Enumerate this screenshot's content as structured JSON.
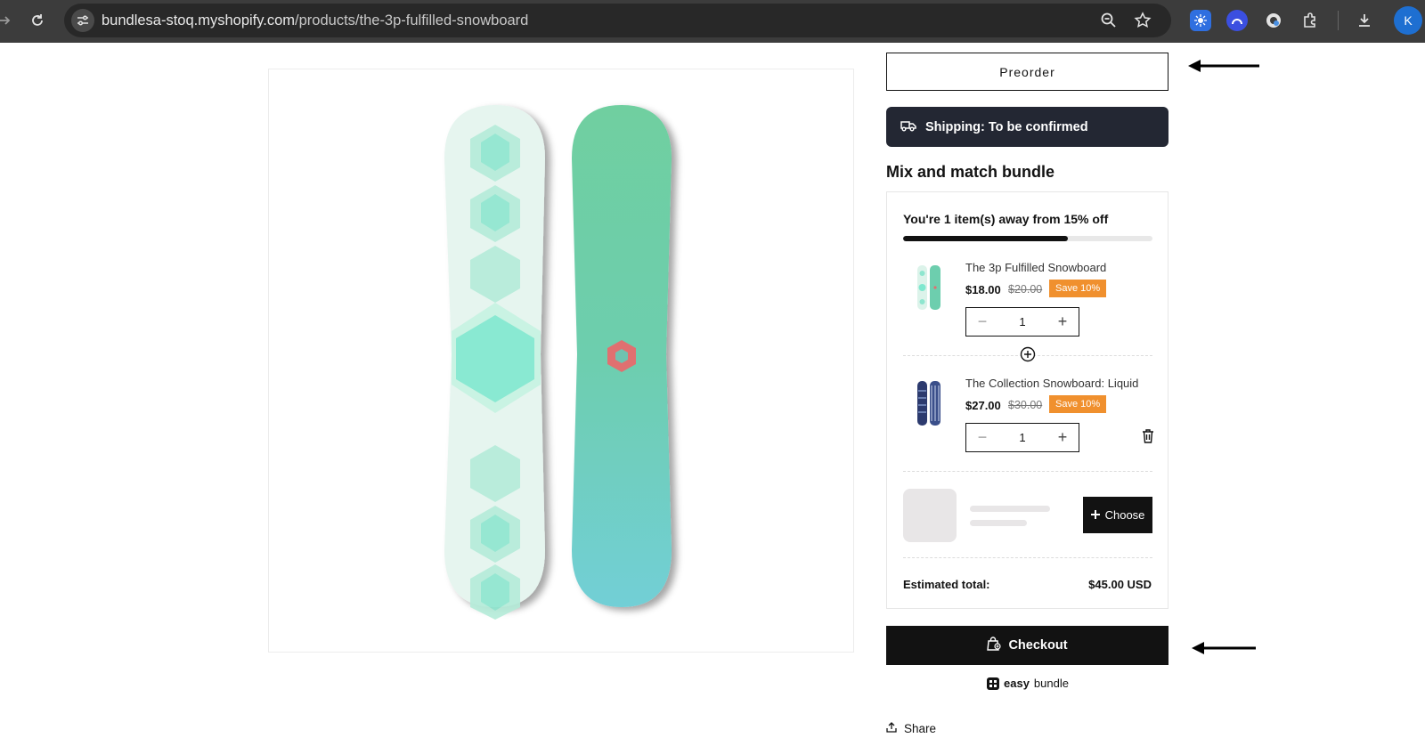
{
  "browser": {
    "url_host": "bundlesa-stoq.myshopify.com",
    "url_path": "/products/the-3p-fulfilled-snowboard",
    "profile_initial": "K",
    "icons": [
      "reload-icon",
      "site-settings-icon",
      "zoom-icon",
      "bookmark-star-icon",
      "extension-icon",
      "extensions-puzzle-icon",
      "download-icon"
    ]
  },
  "product": {
    "preorder_label": "Preorder",
    "shipping_label": "Shipping: To be confirmed"
  },
  "bundle": {
    "title": "Mix and match bundle",
    "progress_text": "You're 1 item(s) away from 15% off",
    "progress_fraction": 0.66,
    "items": [
      {
        "name": "The 3p Fulfilled Snowboard",
        "price": "$18.00",
        "compare_price": "$20.00",
        "badge": "Save 10%",
        "quantity": "1"
      },
      {
        "name": "The Collection Snowboard: Liquid",
        "price": "$27.00",
        "compare_price": "$30.00",
        "badge": "Save 10%",
        "quantity": "1"
      }
    ],
    "choose_label": "Choose",
    "total_label": "Estimated total:",
    "total_value": "$45.00 USD"
  },
  "checkout_label": "Checkout",
  "branding": {
    "easy": "easy",
    "bundle": "bundle"
  },
  "share_label": "Share",
  "colors": {
    "dark": "#121212",
    "shipping_bg": "#232733",
    "badge": "#f0902e",
    "chrome": "#3c3c3c"
  }
}
